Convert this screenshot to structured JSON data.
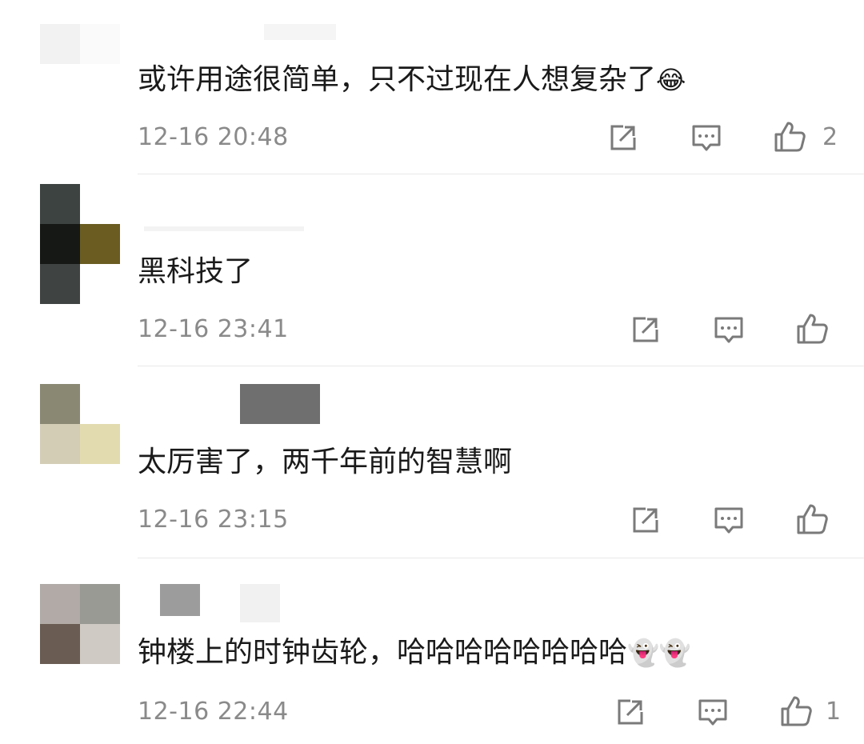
{
  "comments": [
    {
      "text": "或许用途很简单，只不过现在人想复杂了",
      "emoji": "😂",
      "timestamp": "12-16 20:48",
      "like_count": "2",
      "avatar_colors": [
        "#f2f2f2",
        "#fafafa",
        "#ffffff",
        "#ffffff"
      ]
    },
    {
      "text": "黑科技了",
      "emoji": "",
      "timestamp": "12-16 23:41",
      "like_count": "",
      "avatar_colors": [
        "#3c4340",
        "#ffffff",
        "#161816",
        "#6b5d21",
        "#3f4341",
        "#ffffff"
      ]
    },
    {
      "text": "太厉害了，两千年前的智慧啊",
      "emoji": "",
      "timestamp": "12-16 23:15",
      "like_count": "",
      "avatar_colors": [
        "#8a8873",
        "#ffffff",
        "#d4cdb6",
        "#e2dbb0"
      ]
    },
    {
      "text": "钟楼上的时钟齿轮，哈哈哈哈哈哈哈哈",
      "emoji": "👻👻",
      "timestamp": "12-16 22:44",
      "like_count": "1",
      "avatar_colors": [
        "#b1aaa6",
        "#999a94",
        "#6a5c52",
        "#cfcac3"
      ]
    }
  ],
  "icons": {
    "share": "share-icon",
    "reply": "comment-icon",
    "like": "thumbs-up-icon"
  },
  "colors": {
    "text": "#1a1a1a",
    "meta": "#8a8a8a",
    "icon": "#7a7a7a",
    "divider": "#e8e8e8"
  }
}
